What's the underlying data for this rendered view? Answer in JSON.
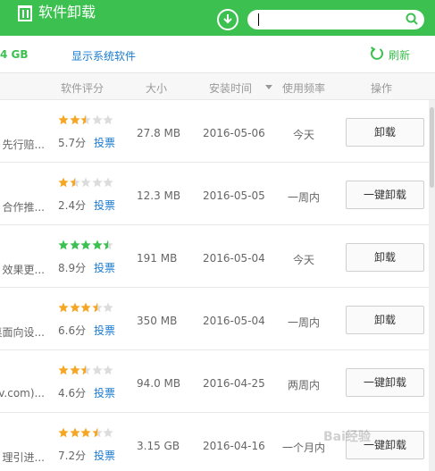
{
  "header": {
    "title": "软件卸载",
    "search_value": ""
  },
  "subbar": {
    "size": "4 GB",
    "show_system_link": "显示系统软件",
    "refresh_label": "刷新"
  },
  "columns": {
    "rating": "软件评分",
    "size": "大小",
    "install_time": "安装时间",
    "frequency": "使用频率",
    "operation": "操作"
  },
  "rows": [
    {
      "desc": "先行赔...",
      "stars": 2.5,
      "rating": "5.7分",
      "vote": "投票",
      "size": "27.8 MB",
      "date": "2016-05-06",
      "freq": "今天",
      "action": "卸载"
    },
    {
      "desc": "合作推...",
      "stars": 1.5,
      "rating": "2.4分",
      "vote": "投票",
      "size": "12.3 MB",
      "date": "2016-05-05",
      "freq": "一周内",
      "action": "一键卸载"
    },
    {
      "desc": "效果更...",
      "stars": 4.5,
      "rating": "8.9分",
      "vote": "投票",
      "size": "191 MB",
      "date": "2016-05-04",
      "freq": "今天",
      "action": "卸载"
    },
    {
      "desc": "桌面向设...",
      "stars": 3.5,
      "rating": "6.6分",
      "vote": "投票",
      "size": "350 MB",
      "date": "2016-05-04",
      "freq": "一周内",
      "action": "卸载"
    },
    {
      "desc": "etv.com)...",
      "stars": 2.5,
      "rating": "4.6分",
      "vote": "投票",
      "size": "94.0 MB",
      "date": "2016-04-25",
      "freq": "两周内",
      "action": "一键卸载"
    },
    {
      "desc": "理引进...",
      "stars": 3.5,
      "rating": "7.2分",
      "vote": "投票",
      "size": "3.15 GB",
      "date": "2016-04-16",
      "freq": "一个月内",
      "action": "一键卸载"
    }
  ],
  "watermark": "Bai经验",
  "colors": {
    "brand_green": "#3cc04f",
    "link_blue": "#1a7bd1",
    "star_orange": "#f5a623",
    "star_green": "#3cc04f",
    "star_empty": "#dcdcdc"
  }
}
